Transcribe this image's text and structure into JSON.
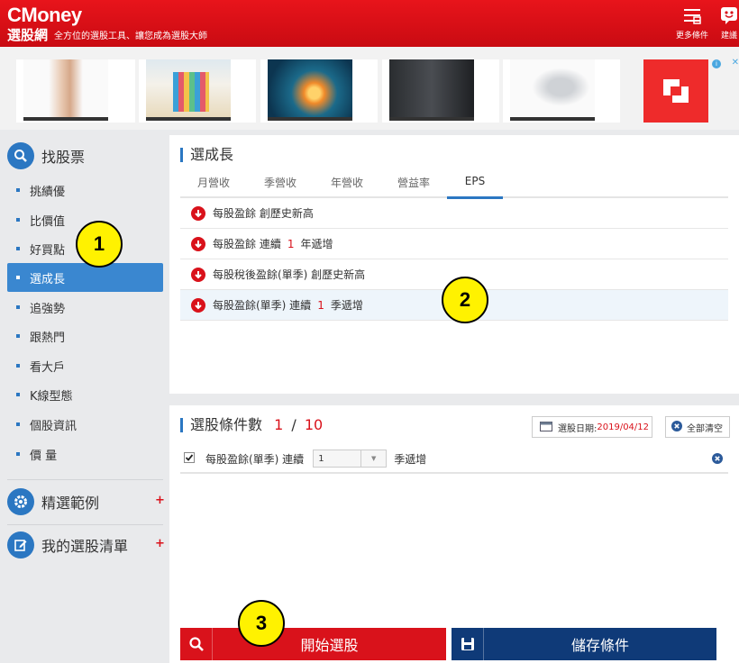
{
  "header": {
    "logo": "CMoney",
    "brand": "選股網",
    "tagline": "全方位的選股工具、讓您成為選股大師",
    "more_label": "更多條件",
    "suggest_label": "建議"
  },
  "ads": {
    "choices_label": "i",
    "close_label": "✕"
  },
  "sidebar": {
    "find_stock": "找股票",
    "items": [
      "挑績優",
      "比價值",
      "好買點",
      "選成長",
      "追強勢",
      "跟熱門",
      "看大戶",
      "K線型態",
      "個股資訊",
      "價 量"
    ],
    "active_index": 3,
    "examples": "精選範例",
    "my_list": "我的選股清單",
    "plus": "+"
  },
  "growth_panel": {
    "title": "選成長",
    "tabs": [
      "月營收",
      "季營收",
      "年營收",
      "營益率",
      "EPS"
    ],
    "active_tab": "EPS",
    "conditions": [
      {
        "pre": "每股盈餘 創歷史新高",
        "num": "",
        "post": ""
      },
      {
        "pre": "每股盈餘 連續",
        "num": "1",
        "post": "年遞增"
      },
      {
        "pre": "每股稅後盈餘(單季) 創歷史新高",
        "num": "",
        "post": ""
      },
      {
        "pre": "每股盈餘(單季) 連續",
        "num": "1",
        "post": "季遞增"
      }
    ]
  },
  "selection_panel": {
    "title": "選股條件數",
    "count": "1",
    "separator": "/",
    "max": "10",
    "date_label": "選股日期:",
    "date_value": "2019/04/12",
    "clear_all": "全部清空",
    "selected_condition": {
      "label": "每股盈餘(單季) 連續",
      "dropdown_value": "1",
      "suffix": "季遞增",
      "checked": true
    }
  },
  "actions": {
    "start": "開始選股",
    "save": "儲存條件"
  },
  "callouts": [
    "1",
    "2",
    "3"
  ],
  "colors": {
    "brand_red": "#d9121b",
    "accent_blue": "#2b77c2",
    "save_navy": "#0f3a78"
  }
}
